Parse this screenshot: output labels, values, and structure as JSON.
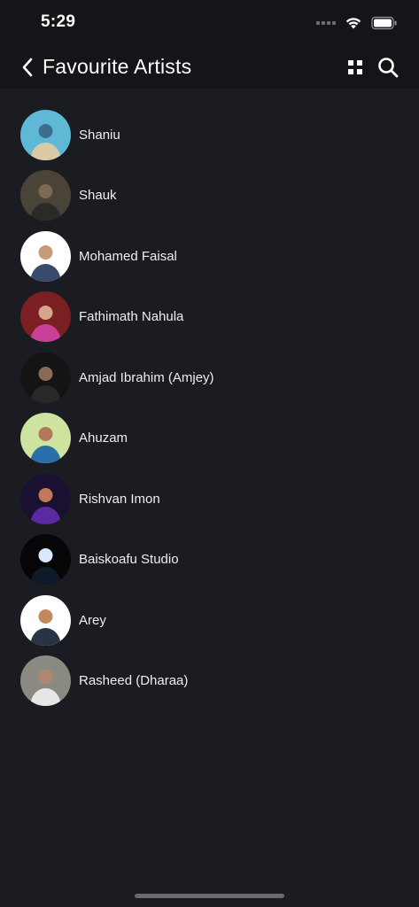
{
  "status_bar": {
    "time": "5:29"
  },
  "header": {
    "title": "Favourite Artists",
    "back_icon": "chevron-left-icon",
    "grid_icon": "grid-icon",
    "search_icon": "search-icon"
  },
  "artists": [
    {
      "name": "Shaniu",
      "colors": [
        "#5fb8d6",
        "#d9c9a4",
        "#3d6f8c"
      ]
    },
    {
      "name": "Shauk",
      "colors": [
        "#4a4338",
        "#2a2a28",
        "#7a6a55"
      ]
    },
    {
      "name": "Mohamed Faisal",
      "colors": [
        "#ffffff",
        "#3a4a6a",
        "#c79a7a"
      ]
    },
    {
      "name": "Fathimath Nahula",
      "colors": [
        "#7a1f22",
        "#c9409a",
        "#d8a48a"
      ]
    },
    {
      "name": "Amjad Ibrahim (Amjey)",
      "colors": [
        "#141414",
        "#2a2826",
        "#8a6a55"
      ]
    },
    {
      "name": "Ahuzam",
      "colors": [
        "#cfe3a0",
        "#2b6fa8",
        "#b07a5a"
      ]
    },
    {
      "name": "Rishvan Imon",
      "colors": [
        "#1a1030",
        "#5a2aa0",
        "#c07a5a"
      ]
    },
    {
      "name": "Baiskoafu Studio",
      "colors": [
        "#060608",
        "#0e1a2a",
        "#d8e8ff"
      ]
    },
    {
      "name": "Arey",
      "colors": [
        "#ffffff",
        "#2a3344",
        "#c08a5a"
      ]
    },
    {
      "name": "Rasheed (Dharaa)",
      "colors": [
        "#8a8a80",
        "#e6e6e6",
        "#b08870"
      ]
    }
  ]
}
